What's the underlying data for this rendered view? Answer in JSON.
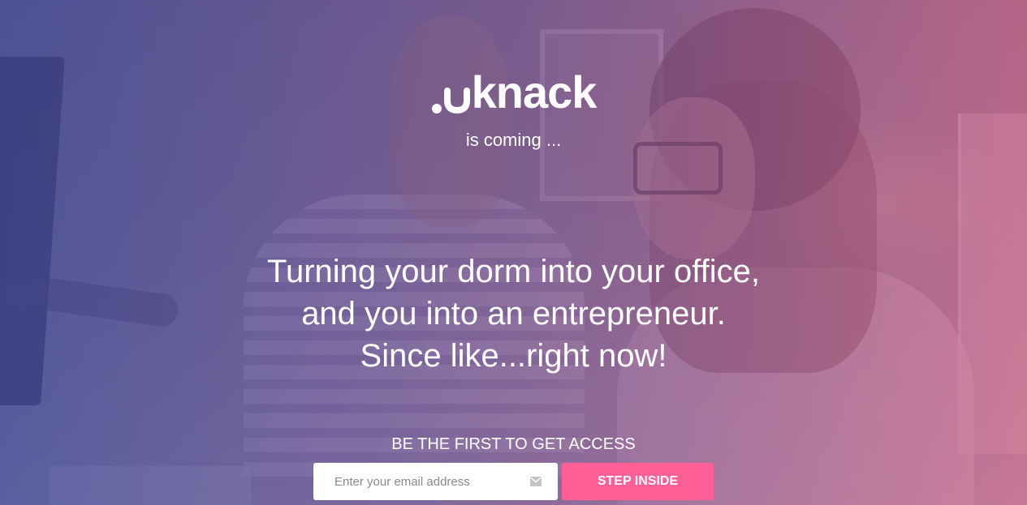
{
  "brand": {
    "logo_text": "knack",
    "tagline": "is coming ..."
  },
  "headline": {
    "lines": [
      "Turning your dorm into your office,",
      "and you into an entrepreneur.",
      "Since like...right now!"
    ]
  },
  "signup": {
    "heading": "BE THE FIRST TO GET ACCESS",
    "email_placeholder": "Enter your email address",
    "email_icon": "mail-icon",
    "submit_label": "STEP INSIDE"
  },
  "colors": {
    "overlay_left": "#3e4896",
    "overlay_right": "#cd5f82",
    "button": "#ff5f97",
    "text": "#ffffff"
  },
  "icons": {
    "logo_mark": "smile-icon"
  }
}
